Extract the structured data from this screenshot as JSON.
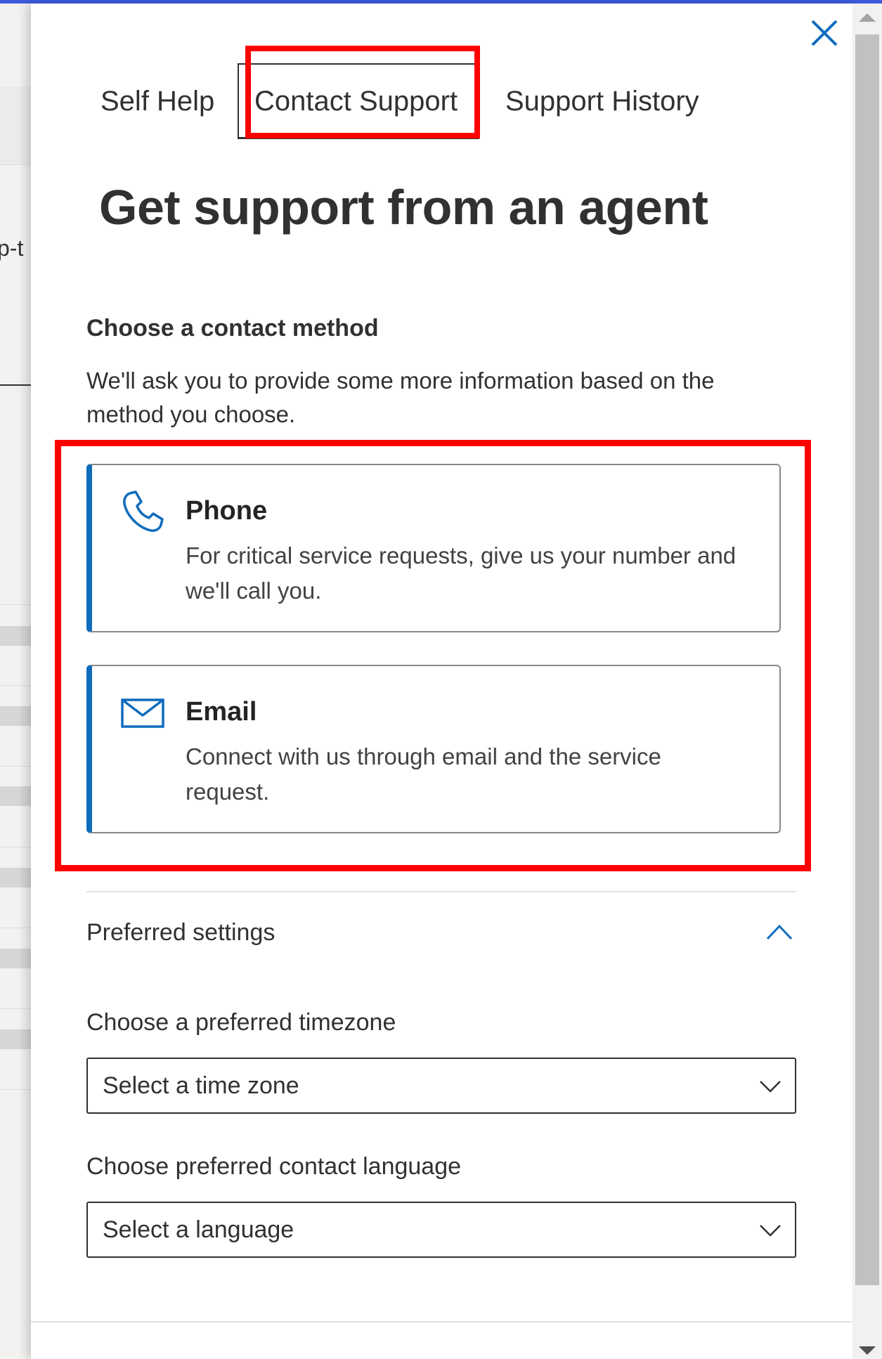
{
  "background_page": {
    "partial_text": "p-t"
  },
  "panel": {
    "close_label": "Close",
    "tabs": [
      {
        "label": "Self Help",
        "selected": false
      },
      {
        "label": "Contact Support",
        "selected": true
      },
      {
        "label": "Support History",
        "selected": false
      }
    ],
    "heading": "Get support from an agent",
    "contact_method": {
      "label": "Choose a contact method",
      "description": "We'll ask you to provide some more information based on the method you choose.",
      "options": [
        {
          "icon": "phone-icon",
          "title": "Phone",
          "description": "For critical service requests, give us your number and we'll call you."
        },
        {
          "icon": "mail-icon",
          "title": "Email",
          "description": "Connect with us through email and the service request."
        }
      ]
    },
    "preferred_settings": {
      "label": "Preferred settings",
      "expanded": true,
      "timezone": {
        "label": "Choose a preferred timezone",
        "value": "Select a time zone"
      },
      "language": {
        "label": "Choose preferred contact language",
        "value": "Select a language"
      }
    }
  },
  "colors": {
    "accent": "#0f6cbd",
    "highlight": "#ff0000",
    "text": "#323130"
  }
}
